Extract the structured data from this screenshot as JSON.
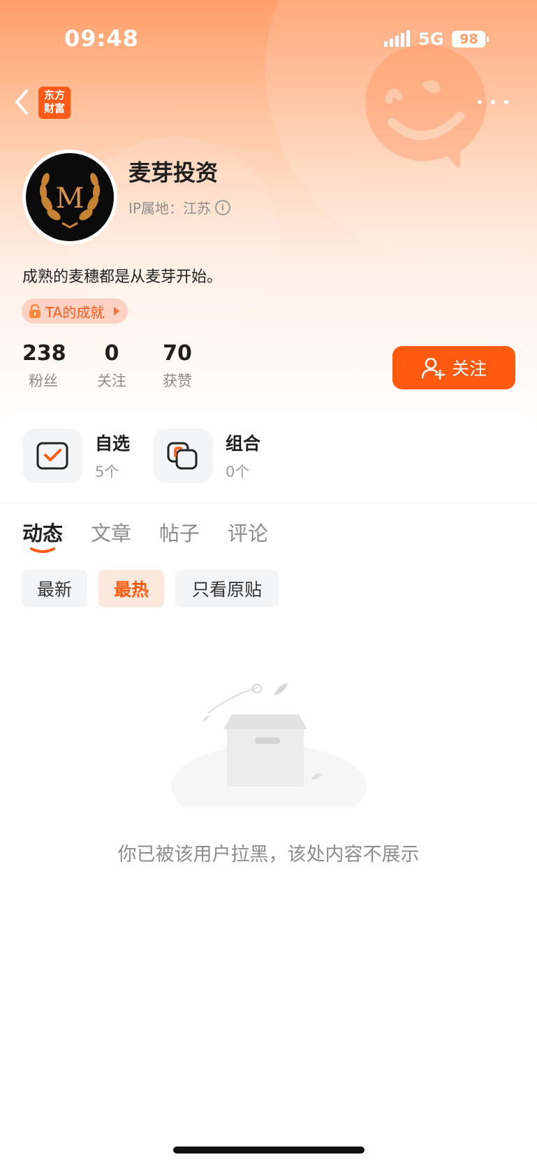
{
  "status_bar": {
    "time": "09:48",
    "network": "5G",
    "battery": "98"
  },
  "header": {
    "logo_line1": "东方",
    "logo_line2": "财富"
  },
  "profile": {
    "name": "麦芽投资",
    "ip_location": "IP属地：江苏",
    "bio": "成熟的麦穗都是从麦芽开始。",
    "achievement_label": "TA的成就",
    "avatar_letter": "M"
  },
  "stats": [
    {
      "num": "238",
      "label": "粉丝"
    },
    {
      "num": "0",
      "label": "关注"
    },
    {
      "num": "70",
      "label": "获赞"
    }
  ],
  "follow_button": {
    "label": "关注"
  },
  "quick_links": [
    {
      "title": "自选",
      "count": "5个"
    },
    {
      "title": "组合",
      "count": "0个"
    }
  ],
  "tabs": [
    {
      "label": "动态",
      "active": true
    },
    {
      "label": "文章",
      "active": false
    },
    {
      "label": "帖子",
      "active": false
    },
    {
      "label": "评论",
      "active": false
    }
  ],
  "filters": [
    {
      "label": "最新",
      "active": false
    },
    {
      "label": "最热",
      "active": true
    },
    {
      "label": "只看原贴",
      "active": false
    }
  ],
  "empty_state": {
    "message": "你已被该用户拉黑，该处内容不展示"
  },
  "colors": {
    "accent": "#ff5a10",
    "brand": "#ff5a17",
    "hero_top": "#ff9e6a"
  }
}
